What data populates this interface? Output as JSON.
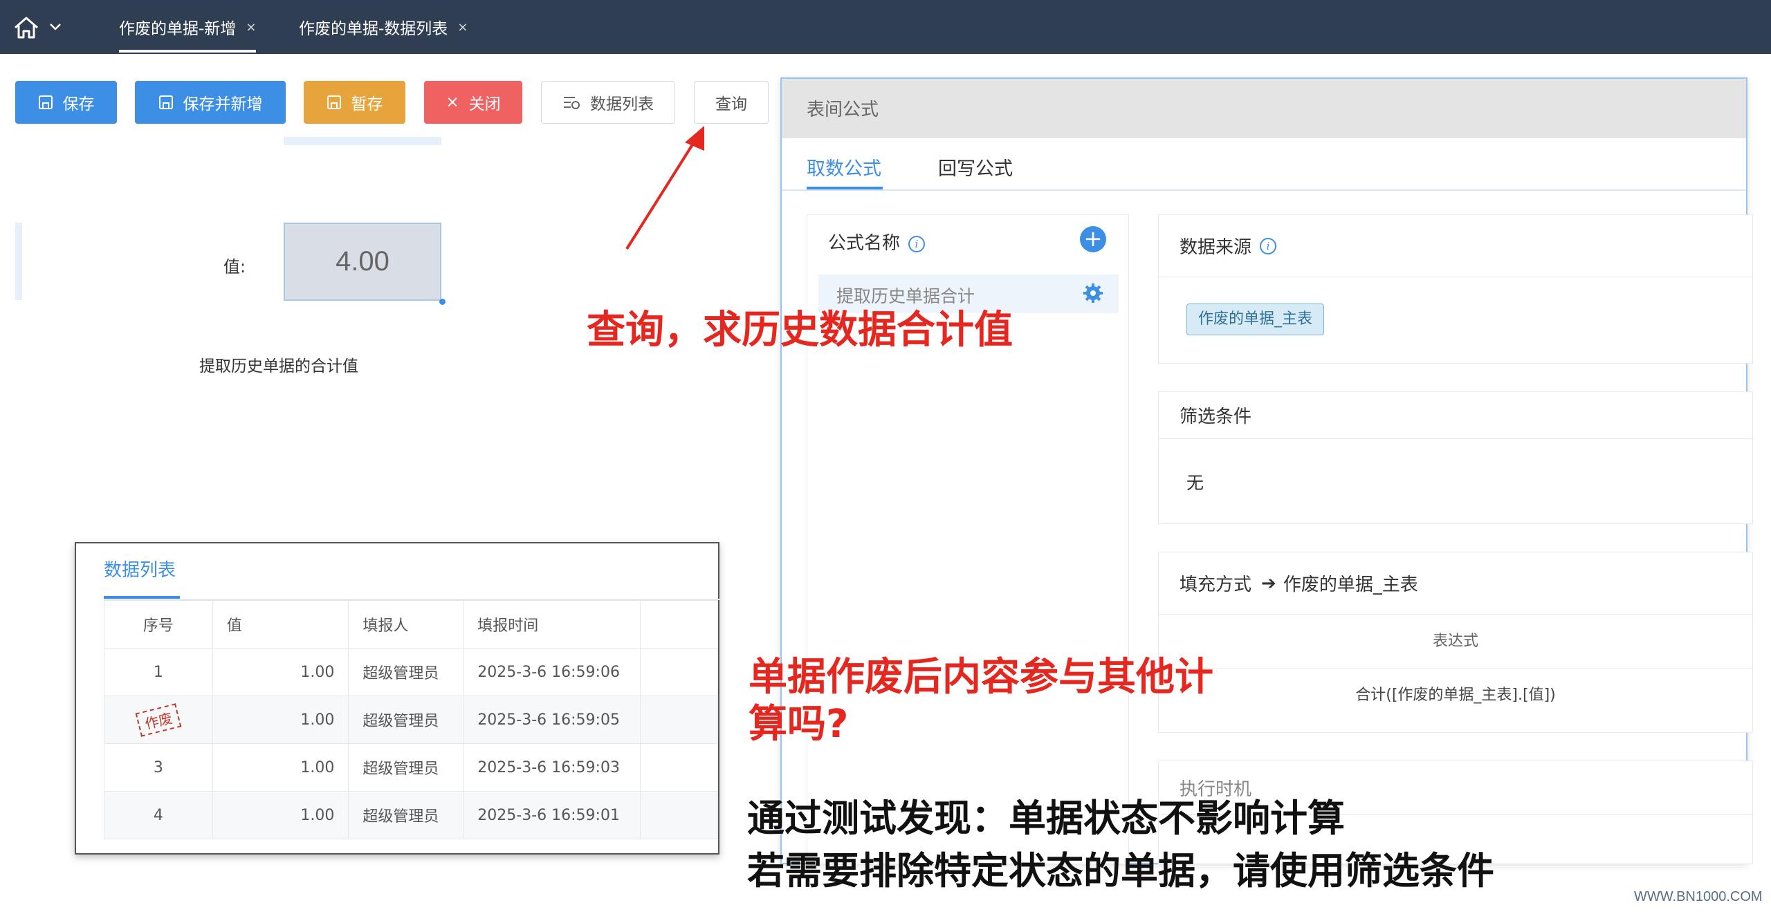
{
  "tabs": [
    {
      "label": "作废的单据-新增",
      "close": "×",
      "active": true
    },
    {
      "label": "作废的单据-数据列表",
      "close": "×",
      "active": false
    }
  ],
  "toolbar": {
    "save": "保存",
    "save_new": "保存并新增",
    "draft": "暂存",
    "close": "关闭",
    "close_icon": "×",
    "data_list": "数据列表",
    "query": "查询"
  },
  "form": {
    "value_label": "值:",
    "value": "4.00",
    "hint": "提取历史单据的合计值"
  },
  "data_list": {
    "title": "数据列表",
    "columns": [
      "序号",
      "值",
      "填报人",
      "填报时间"
    ],
    "rows": [
      {
        "no": "1",
        "value": "1.00",
        "user": "超级管理员",
        "time": "2025-3-6 16:59:06"
      },
      {
        "no": "2",
        "value": "1.00",
        "user": "超级管理员",
        "time": "2025-3-6 16:59:05",
        "stamp": "作废"
      },
      {
        "no": "3",
        "value": "1.00",
        "user": "超级管理员",
        "time": "2025-3-6 16:59:03"
      },
      {
        "no": "4",
        "value": "1.00",
        "user": "超级管理员",
        "time": "2025-3-6 16:59:01"
      }
    ]
  },
  "dialog": {
    "title": "表间公式",
    "tabs": [
      "取数公式",
      "回写公式"
    ],
    "formula_name_label": "公式名称",
    "add_icon": "+",
    "formula_item": "提取历史单据合计",
    "data_source_label": "数据来源",
    "data_source_tag": "作废的单据_主表",
    "filter_label": "筛选条件",
    "filter_value": "无",
    "fill_label": "填充方式",
    "fill_arrow": "➔",
    "fill_target": "作废的单据_主表",
    "expr_header": "表达式",
    "expr_value": "合计([作废的单据_主表].[值])",
    "exec_label": "执行时机"
  },
  "annotations": {
    "top": "查询，求历史数据合计值",
    "mid_line1": "单据作废后内容参与其他计",
    "mid_line2": "算吗?",
    "bottom_line1": "通过测试发现：单据状态不影响计算",
    "bottom_line2": "若需要排除特定状态的单据，请使用筛选条件"
  },
  "watermark": "WWW.BN1000.COM",
  "colors": {
    "primary": "#3d8fe6",
    "warning": "#e8a43c",
    "danger": "#f06262",
    "topbar": "#2f3e52",
    "annotation_red": "#e5271f"
  }
}
